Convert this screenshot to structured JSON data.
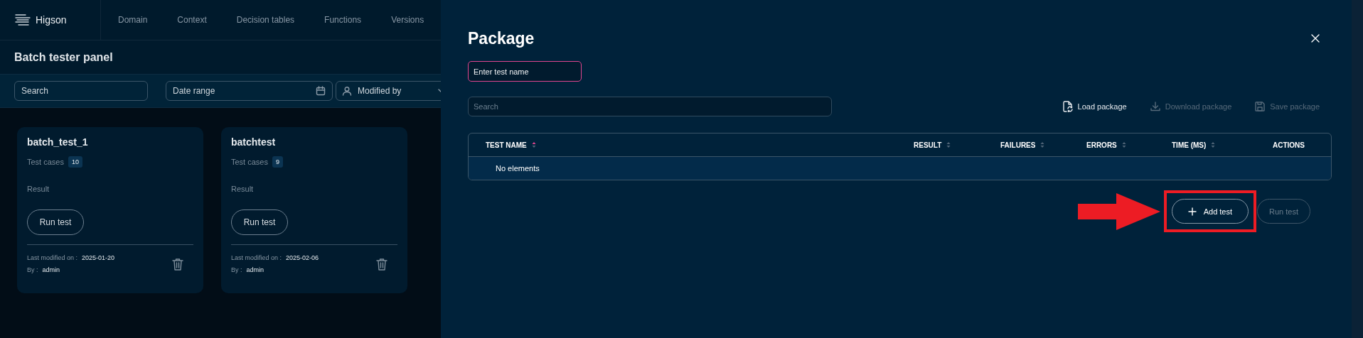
{
  "app": {
    "logo": "Higson",
    "nav": [
      {
        "label": "Domain"
      },
      {
        "label": "Context"
      },
      {
        "label": "Decision tables"
      },
      {
        "label": "Functions"
      },
      {
        "label": "Versions"
      }
    ]
  },
  "page": {
    "title": "Batch tester panel",
    "filters": [
      {
        "kind": "text",
        "placeholder": "Search"
      },
      {
        "kind": "date",
        "placeholder": "Date range"
      },
      {
        "kind": "select",
        "placeholder": "Modified by"
      }
    ]
  },
  "cards": [
    {
      "title": "batch_test_1",
      "cases_label": "Test cases",
      "cases": "10",
      "result_label": "Result",
      "button": "Run test",
      "modified_label": "Last modified on :",
      "modified": "2025-01-20",
      "by_label": "By :",
      "by": "admin"
    },
    {
      "title": "batchtest",
      "cases_label": "Test cases",
      "cases": "9",
      "result_label": "Result",
      "button": "Run test",
      "modified_label": "Last modified on :",
      "modified": "2025-02-06",
      "by_label": "By :",
      "by": "admin"
    }
  ],
  "dialog": {
    "title": "Package",
    "name_field": {
      "placeholder": "Enter test name",
      "focused": true
    },
    "search": {
      "placeholder": "Search"
    },
    "actions": [
      {
        "kind": "load",
        "label": "Load package",
        "disabled": false
      },
      {
        "kind": "download",
        "label": "Download package",
        "disabled": true
      },
      {
        "kind": "save",
        "label": "Save package",
        "disabled": true
      }
    ],
    "table": {
      "columns": [
        {
          "label": "TEST NAME",
          "sortable": true,
          "sorted": true
        },
        {
          "label": "RESULT",
          "sortable": true,
          "sorted": false
        },
        {
          "label": "FAILURES",
          "sortable": true,
          "sorted": false
        },
        {
          "label": "ERRORS",
          "sortable": true,
          "sorted": false
        },
        {
          "label": "TIME (MS)",
          "sortable": true,
          "sorted": false
        },
        {
          "label": "ACTIONS",
          "sortable": false
        }
      ],
      "empty": "No elements"
    },
    "buttons": [
      {
        "kind": "add",
        "label": "Add test",
        "disabled": false,
        "highlighted": true
      },
      {
        "kind": "run",
        "label": "Run test",
        "disabled": true,
        "highlighted": false
      }
    ]
  }
}
